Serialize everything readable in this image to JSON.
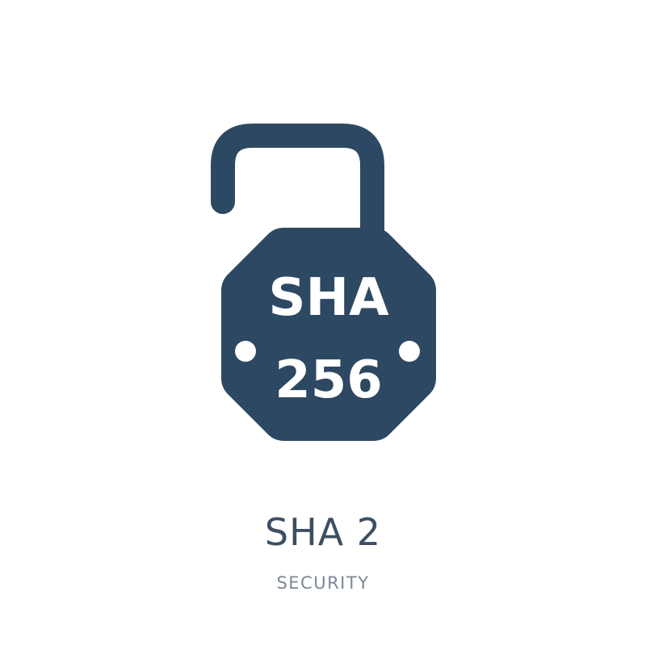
{
  "icon": {
    "name": "octagon-padlock-icon",
    "label_line1": "SHA",
    "label_line2": "256"
  },
  "caption": {
    "title": "SHA 2",
    "category": "SECURITY"
  },
  "colors": {
    "icon_fill": "#2d4862",
    "icon_text": "#ffffff",
    "title_text": "#3c4f63",
    "subtitle_text": "#7b8896",
    "background": "#ffffff"
  }
}
